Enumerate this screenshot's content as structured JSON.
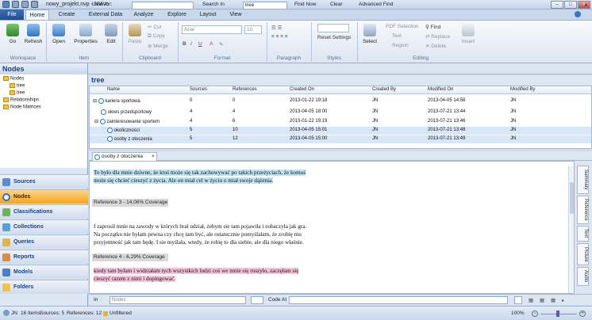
{
  "window": {
    "title": "nowy_projekt.nvp - NVivo",
    "min": "–",
    "max": "□",
    "close": "×"
  },
  "tabs": {
    "file": "File",
    "items": [
      "Home",
      "Create",
      "External Data",
      "Analyze",
      "Explore",
      "Layout",
      "View"
    ]
  },
  "ribbon": {
    "go": "Go",
    "refresh": "Refresh",
    "open": "Open",
    "properties": "Properties",
    "edit": "Edit",
    "paste": "Paste",
    "cut": "Cut",
    "copy": "Copy",
    "merge": "Merge",
    "font": "Arial",
    "font_size": "10",
    "reset_settings": "Reset Settings",
    "select": "Select",
    "pdf_selection": "PDF Selection",
    "text": "Text",
    "region": "Region",
    "find": "Find",
    "replace": "Replace",
    "delete": "Delete",
    "insert": "Insert",
    "groups": {
      "workspace": "Workspace",
      "item": "Item",
      "clipboard": "Clipboard",
      "format": "Format",
      "paragraph": "Paragraph",
      "styles": "Styles",
      "editing": "Editing"
    }
  },
  "findbar": {
    "look_for": "Look for:",
    "search_in": "Search In",
    "search_value": "tree",
    "find_now": "Find Now",
    "clear": "Clear",
    "advanced_find": "Advanced Find"
  },
  "nav": {
    "title": "Nodes",
    "tree": [
      {
        "label": "Nodes",
        "level": 0
      },
      {
        "label": "tree",
        "level": 1
      },
      {
        "label": "tree",
        "level": 1
      },
      {
        "label": "Relationships",
        "level": 0
      },
      {
        "label": "Node Matrices",
        "level": 0
      }
    ],
    "buttons": [
      "Sources",
      "Nodes",
      "Classifications",
      "Collections",
      "Queries",
      "Reports",
      "Models",
      "Folders"
    ]
  },
  "list": {
    "title": "tree",
    "headers": [
      "Name",
      "Sources",
      "References",
      "Created On",
      "Created By",
      "Modified On",
      "Modified By"
    ],
    "rows": [
      [
        "kariera sportowa",
        "0",
        "0",
        "2013-01-22 19:18",
        "JN",
        "2013-04-05 14:58",
        "JN"
      ],
      [
        "okres przedsportowy",
        "4",
        "4",
        "2013-04-05 18:00",
        "JN",
        "2013-07-21 13:44",
        "JN"
      ],
      [
        "zainteresowanie sportem",
        "4",
        "6",
        "2013-01-22 19:19",
        "JN",
        "2013-07-21 13:46",
        "JN"
      ],
      [
        "okoliczności",
        "5",
        "10",
        "2013-04-05 15:01",
        "JN",
        "2013-07-21 13:48",
        "JN"
      ],
      [
        "osoby z otoczenia",
        "5",
        "12",
        "2013-04-05 15:00",
        "JN",
        "2013-07-21 13:49",
        "JN"
      ]
    ]
  },
  "doc": {
    "tab": "osoby z otoczenia",
    "p1_l1": "To było dla mnie dziwne, że ktoś może się tak zachowywać po takich przeżyciach, że komuś",
    "p1_l2": "może się chcieć cieszyć z życia. Ale on miał cel w życiu o miał swoje dążenia.",
    "ref3": "Reference 3 - 14,06% Coverage",
    "p2_l1": "I zaprosił mnie na zawody w których brał udział, żebym sie tam pojawiła i zobaczyła jak gra.",
    "p2_l2": "Na początku nie byłam pewna czy chcę tam być, ale ostatecznie pomyślałam, że zrobię mu",
    "p2_l3": "przyjemność jak tam będę. I sie myślała, wtedy, że robię to dla siebie, ale dla niego właśnie.",
    "ref4": "Reference 4 - 6,29% Coverage",
    "p3_l1": " kiedy tam byłam i widziałam tych wszystkich ludzi coś we mnie się ruszyło, zaczęłam się",
    "p3_l2": "cieszyć razem z nimi i dopingować.",
    "right_tabs": [
      "Summary",
      "Reference",
      "Text",
      "Picture",
      "Audio"
    ]
  },
  "bottom": {
    "in": "In",
    "nodes": "Nodes",
    "code_at": "Code At"
  },
  "status": {
    "user": "JN",
    "items": "16 Items",
    "sources": "Sources: 5",
    "references": "References: 12",
    "unfiltered": "Unfiltered",
    "zoom": "100%"
  },
  "colors": {
    "accent": "#15428b",
    "nav_active": "#f4a51d",
    "highlight_blue": "#bfe3f4",
    "highlight_pink": "#f5c3d8"
  }
}
